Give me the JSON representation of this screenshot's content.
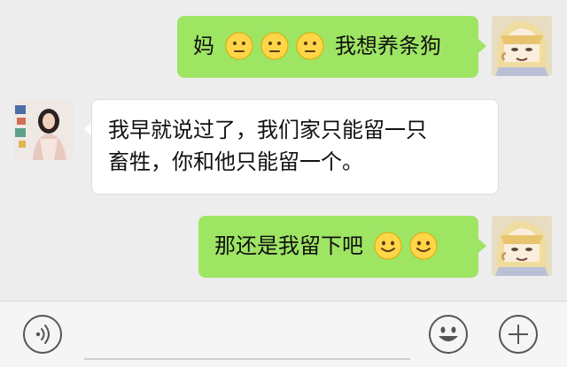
{
  "messages": [
    {
      "side": "right",
      "text_before": "妈",
      "emoji": [
        "neutral-face",
        "neutral-face",
        "neutral-face"
      ],
      "text_after": "我想养条狗"
    },
    {
      "side": "left",
      "line1": "我早就说过了，我们家只能留一只",
      "line2": "畜牲，你和他只能留一个。"
    },
    {
      "side": "right",
      "text_before": "那还是我留下吧",
      "emoji": [
        "smiling-face",
        "smiling-face"
      ]
    }
  ],
  "colors": {
    "sent_bubble": "#9ee563",
    "received_bubble": "#ffffff",
    "chat_background": "#ededed",
    "toolbar_background": "#f5f5f5"
  },
  "toolbar": {
    "voice_icon": "voice-icon",
    "emoji_icon": "emoji-icon",
    "plus_icon": "plus-icon"
  }
}
